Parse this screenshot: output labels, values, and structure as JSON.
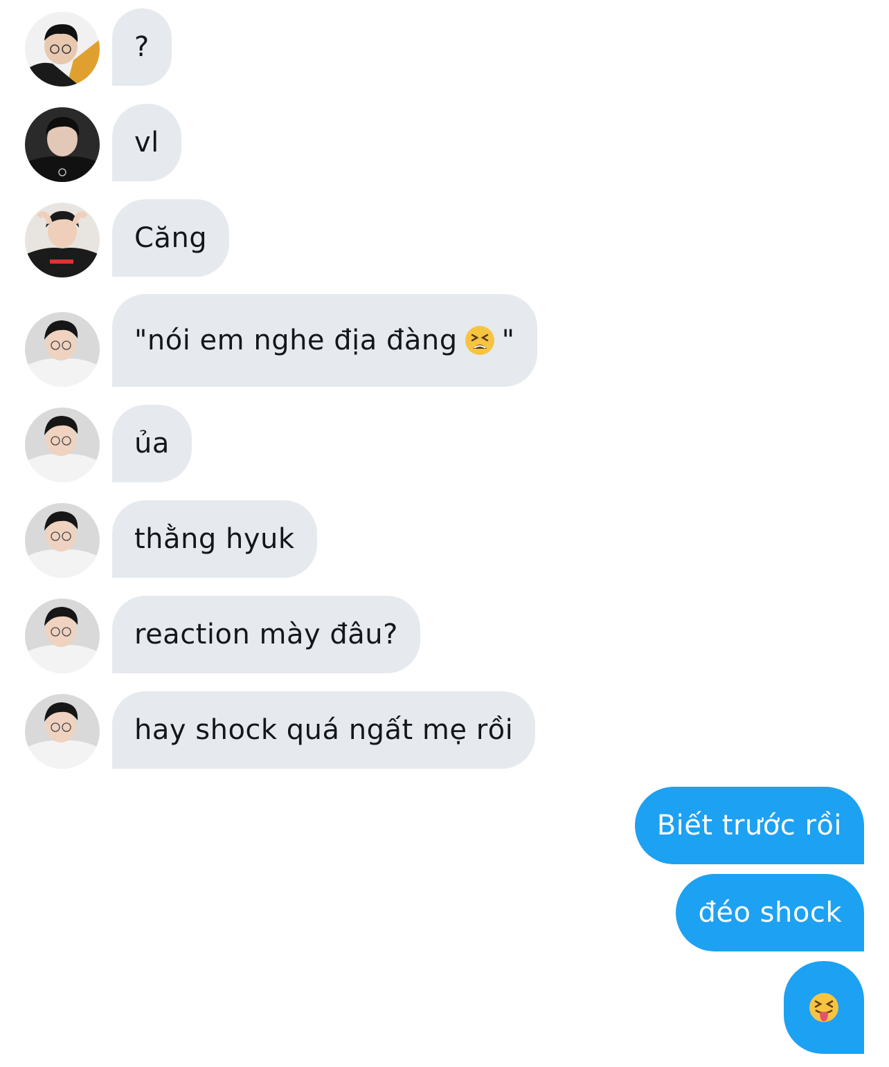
{
  "conversation": {
    "incoming": [
      {
        "text": "?",
        "sender": "avatar-1"
      },
      {
        "text": "vl",
        "sender": "avatar-2"
      },
      {
        "text": "Căng",
        "sender": "avatar-3"
      },
      {
        "text_before_emoji": "\"nói em nghe địa đàng",
        "emoji": "tired-face-icon",
        "text_after_emoji": "\"",
        "sender": "avatar-4"
      },
      {
        "text": "ủa",
        "sender": "avatar-4"
      },
      {
        "text": "thằng hyuk",
        "sender": "avatar-4"
      },
      {
        "text": "reaction mày đâu?",
        "sender": "avatar-4"
      },
      {
        "text": "hay shock quá ngất mẹ rồi",
        "sender": "avatar-4"
      }
    ],
    "outgoing": [
      {
        "text": "Biết trước rồi"
      },
      {
        "text": "đéo shock"
      },
      {
        "emoji": "squinting-tongue-face-icon"
      }
    ]
  },
  "colors": {
    "incoming_bubble": "#e6eaee",
    "incoming_text": "#14171a",
    "outgoing_bubble": "#1da1f2",
    "outgoing_text": "#ffffff",
    "background": "#ffffff"
  }
}
